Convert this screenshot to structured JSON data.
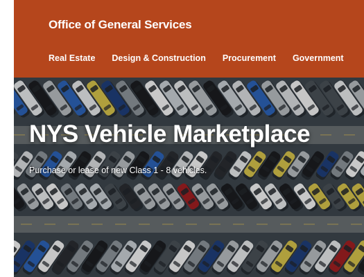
{
  "header": {
    "agency_name": "Office of General Services",
    "background_color": "#b5461c",
    "nav": [
      {
        "label": "Real Estate"
      },
      {
        "label": "Design & Construction"
      },
      {
        "label": "Procurement"
      },
      {
        "label": "Government"
      }
    ]
  },
  "hero": {
    "title": "NYS Vehicle Marketplace",
    "subtitle": "Purchase or lease of new Class 1 - 8 vehicles.",
    "image": "parking-lot-aerial-photo"
  }
}
